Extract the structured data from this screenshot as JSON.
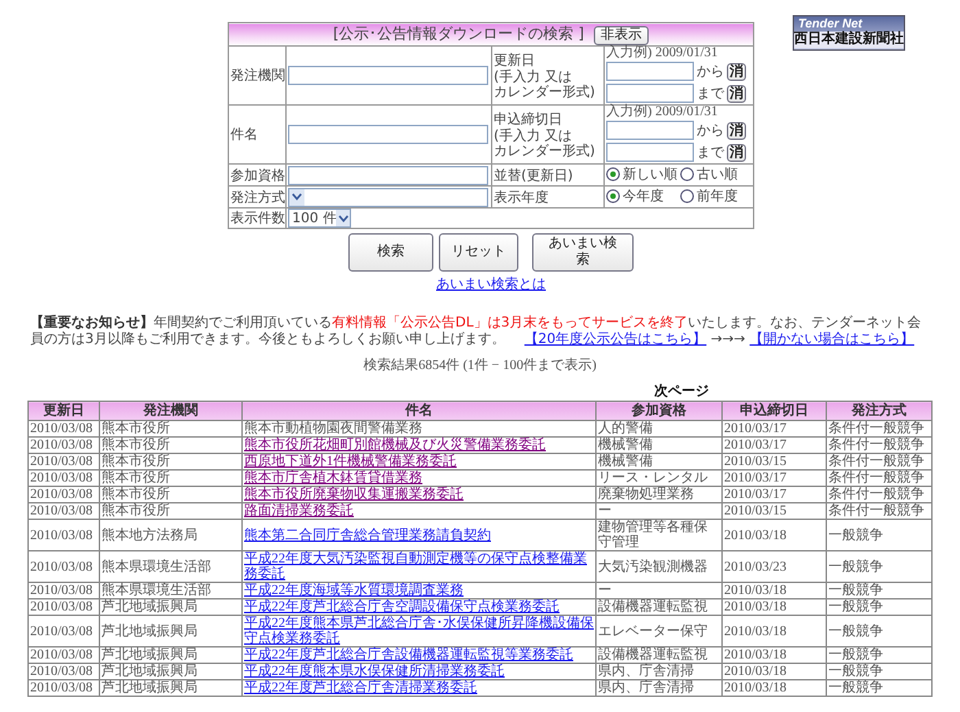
{
  "logo": {
    "brand": "Tender Net",
    "company": "西日本建設新聞社"
  },
  "search_form": {
    "title": "[公示･公告情報ダウンロードの検索 ]",
    "hide_button": "非表示",
    "agency": {
      "label": "発注機関"
    },
    "name": {
      "label": "件名"
    },
    "qualification": {
      "label": "参加資格"
    },
    "method": {
      "label": "発注方式"
    },
    "count": {
      "label": "表示件数",
      "value": "100 件"
    },
    "date_ranges": [
      {
        "label": "更新日",
        "note_lines": [
          "(手入力 又は",
          "カレンダー形式)"
        ],
        "example": "入力例) 2009/01/31",
        "from_label": "から",
        "to_label": "まで",
        "from_clear": "消",
        "to_clear": "消"
      },
      {
        "label": "申込締切日",
        "note_lines": [
          "(手入力 又は",
          "カレンダー形式)"
        ],
        "example": "入力例) 2009/01/31",
        "from_label": "から",
        "to_label": "まで",
        "from_clear": "消",
        "to_clear": "消"
      }
    ],
    "radio_groups": [
      {
        "label": "並替(更新日)",
        "options": [
          {
            "label": "新しい順",
            "selected": true
          },
          {
            "label": "古い順",
            "selected": false
          }
        ]
      },
      {
        "label": "表示年度",
        "options": [
          {
            "label": "今年度",
            "selected": true
          },
          {
            "label": "前年度",
            "selected": false
          }
        ]
      }
    ],
    "buttons": [
      "検索",
      "リセット",
      "あいまい検索"
    ],
    "help_link": "あいまい検索とは"
  },
  "notice": {
    "label": "【重要なお知らせ】",
    "text_before": "年間契約でご利用頂いている",
    "highlight": "有料情報「公示公告DL」は3月末をもってサービスを終了",
    "text_after": "いたします。なお、テンダーネット会員の方は3月以降もご利用できます。今後ともよろしくお願い申し上げます。",
    "link": "【20年度公示公告はこちら】",
    "arrow": "→→→",
    "fallback_link": "【開かない場合はこちら】"
  },
  "results_summary": "検索結果6854件 (1件 − 100件まで表示)",
  "next_page": "次ページ",
  "table": {
    "columns": [
      "更新日",
      "発注機関",
      "件名",
      "参加資格",
      "申込締切日",
      "発注方式"
    ],
    "rows": [
      {
        "cells": [
          "2010/03/08",
          "熊本市役所",
          "熊本市動植物園夜間警備業務",
          "人的警備",
          "2010/03/17",
          "条件付一般競争"
        ],
        "linked": false
      },
      {
        "cells": [
          "2010/03/08",
          "熊本市役所",
          "熊本市役所花畑町別館機械及び火災警備業務委託",
          "機械警備",
          "2010/03/17",
          "条件付一般競争"
        ],
        "linked": true,
        "visited": true
      },
      {
        "cells": [
          "2010/03/08",
          "熊本市役所",
          "西原地下道外1件機械警備業務委託",
          "機械警備",
          "2010/03/15",
          "条件付一般競争"
        ],
        "linked": true,
        "visited": true
      },
      {
        "cells": [
          "2010/03/08",
          "熊本市役所",
          "熊本市庁舎植木鉢賃貸借業務",
          "リース・レンタル",
          "2010/03/17",
          "条件付一般競争"
        ],
        "linked": true,
        "visited": true
      },
      {
        "cells": [
          "2010/03/08",
          "熊本市役所",
          "熊本市役所廃棄物収集運搬業務委託",
          "廃棄物処理業務",
          "2010/03/17",
          "条件付一般競争"
        ],
        "linked": true,
        "visited": true
      },
      {
        "cells": [
          "2010/03/08",
          "熊本市役所",
          "路面清掃業務委託",
          "ー",
          "2010/03/15",
          "条件付一般競争"
        ],
        "linked": true,
        "visited": true
      },
      {
        "cells": [
          "2010/03/08",
          "熊本地方法務局",
          "熊本第二合同庁舎総合管理業務請負契約",
          "建物管理等各種保守管理",
          "2010/03/18",
          "一般競争"
        ],
        "linked": true,
        "visited": false
      },
      {
        "cells": [
          "2010/03/08",
          "熊本県環境生活部",
          "平成22年度大気汚染監視自動測定機等の保守点検整備業務委託",
          "大気汚染観測機器",
          "2010/03/23",
          "一般競争"
        ],
        "linked": true,
        "visited": false
      },
      {
        "cells": [
          "2010/03/08",
          "熊本県環境生活部",
          "平成22年度海域等水質環境調査業務",
          "ー",
          "2010/03/18",
          "一般競争"
        ],
        "linked": true,
        "visited": false
      },
      {
        "cells": [
          "2010/03/08",
          "芦北地域振興局",
          "平成22年度芦北総合庁舎空調設備保守点検業務委託",
          "設備機器運転監視",
          "2010/03/18",
          "一般競争"
        ],
        "linked": true,
        "visited": false
      },
      {
        "cells": [
          "2010/03/08",
          "芦北地域振興局",
          "平成22年度熊本県芦北総合庁舎･水俣保健所昇降機設備保守点検業務委託",
          "エレベーター保守",
          "2010/03/18",
          "一般競争"
        ],
        "linked": true,
        "visited": false
      },
      {
        "cells": [
          "2010/03/08",
          "芦北地域振興局",
          "平成22年度芦北総合庁舎設備機器運転監視等業務委託",
          "設備機器運転監視",
          "2010/03/18",
          "一般競争"
        ],
        "linked": true,
        "visited": false
      },
      {
        "cells": [
          "2010/03/08",
          "芦北地域振興局",
          "平成22年度熊本県水俣保健所清掃業務委託",
          "県内、庁舎清掃",
          "2010/03/18",
          "一般競争"
        ],
        "linked": true,
        "visited": false
      },
      {
        "cells": [
          "2010/03/08",
          "芦北地域振興局",
          "平成22年度芦北総合庁舎清掃業務委託",
          "県内、庁舎清掃",
          "2010/03/18",
          "一般競争"
        ],
        "linked": true,
        "visited": false
      }
    ]
  }
}
